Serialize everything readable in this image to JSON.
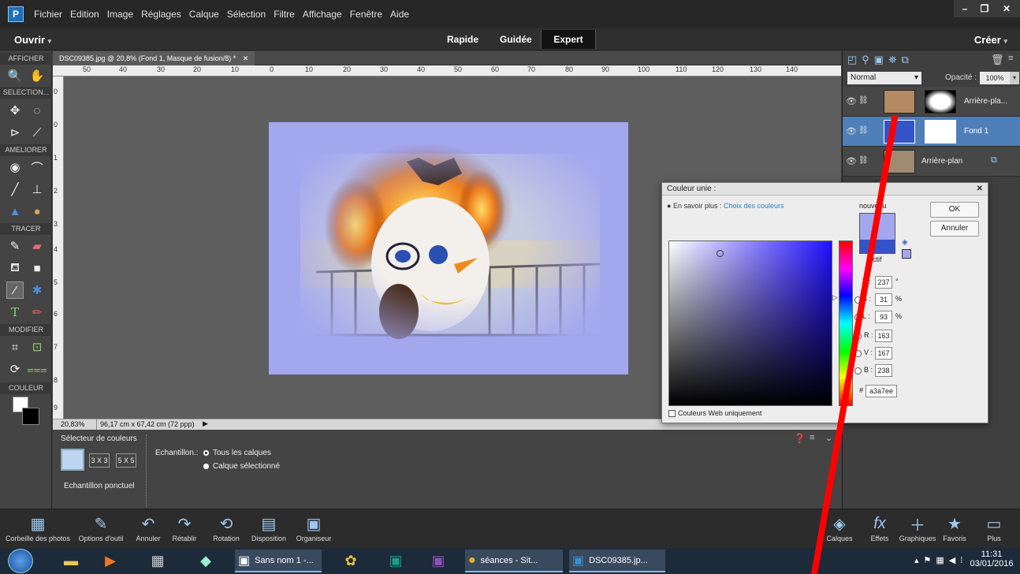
{
  "menubar": {
    "items": [
      "Fichier",
      "Edition",
      "Image",
      "Réglages",
      "Calque",
      "Sélection",
      "Filtre",
      "Affichage",
      "Fenêtre",
      "Aide"
    ]
  },
  "modebar": {
    "open_label": "Ouvrir",
    "create_label": "Créer",
    "tabs": [
      "Rapide",
      "Guidée",
      "Expert"
    ],
    "active_tab": "Expert"
  },
  "left_panel": {
    "sections": [
      "AFFICHER",
      "SELECTION...",
      "AMELIORER",
      "TRACER",
      "MODIFIER",
      "COULEUR"
    ]
  },
  "document": {
    "tab_title": "DSC09385.jpg @ 20,8% (Fond 1, Masque de fusion/8) *",
    "ruler_top": [
      "50",
      "40",
      "30",
      "20",
      "10",
      "0",
      "10",
      "20",
      "30",
      "40",
      "50",
      "60",
      "70",
      "80",
      "90",
      "100",
      "110",
      "120",
      "130",
      "140"
    ],
    "ruler_left": [
      "0",
      "0",
      "1",
      "2",
      "3",
      "4",
      "5",
      "6",
      "7",
      "8",
      "9"
    ],
    "zoom": "20,83%",
    "doc_size": "96,17 cm x 67,42 cm (72 ppp)"
  },
  "options_panel": {
    "title": "Sélecteur de couleurs",
    "sample_3x3": "3 X 3",
    "sample_5x5": "5 X 5",
    "sample_point": "Echantillon ponctuel",
    "sample_label": "Echantillon.:",
    "radio_all": "Tous les calques",
    "radio_selected": "Calque sélectionné"
  },
  "layers_panel": {
    "blend_mode": "Normal",
    "opacity_label": "Opacité :",
    "opacity_value": "100%",
    "layers": [
      {
        "name": "Arrière-pla...",
        "selected": false
      },
      {
        "name": "Fond 1",
        "selected": true
      },
      {
        "name": "Arrière-plan",
        "selected": false
      }
    ]
  },
  "color_dialog": {
    "title": "Couleur unie :",
    "help_prefix": "En savoir plus :",
    "help_link": "Choix des couleurs",
    "new_label": "nouveau",
    "current_label": "actif",
    "ok": "OK",
    "cancel": "Annuler",
    "T": "237",
    "S": "31",
    "L": "93",
    "R": "163",
    "V": "167",
    "B": "238",
    "hex": "a3a7ee",
    "web_only": "Couleurs Web uniquement",
    "unit_deg": "°",
    "unit_pct": "%",
    "label_T": "T :",
    "label_S": "S :",
    "label_L": "L :",
    "label_R": "R :",
    "label_V": "V :",
    "label_B": "B :",
    "label_hex": "#",
    "new_color": "#a3a7ee",
    "current_color": "#3553c8"
  },
  "bottombar": {
    "items": [
      "Corbeille des photos",
      "Options d'outil",
      "Annuler",
      "Rétablir",
      "Rotation",
      "Disposition",
      "Organiseur"
    ],
    "right_items": [
      "Calques",
      "Effets",
      "Graphiques",
      "Favoris",
      "Plus"
    ]
  },
  "taskbar": {
    "items": [
      "Sans nom 1 -...",
      "séances - Sit...",
      "DSC09385.jp..."
    ],
    "time": "11:31",
    "date": "03/01/2016"
  },
  "colors": {
    "accent": "#4f7fb8",
    "annotation": "#ff0000"
  }
}
